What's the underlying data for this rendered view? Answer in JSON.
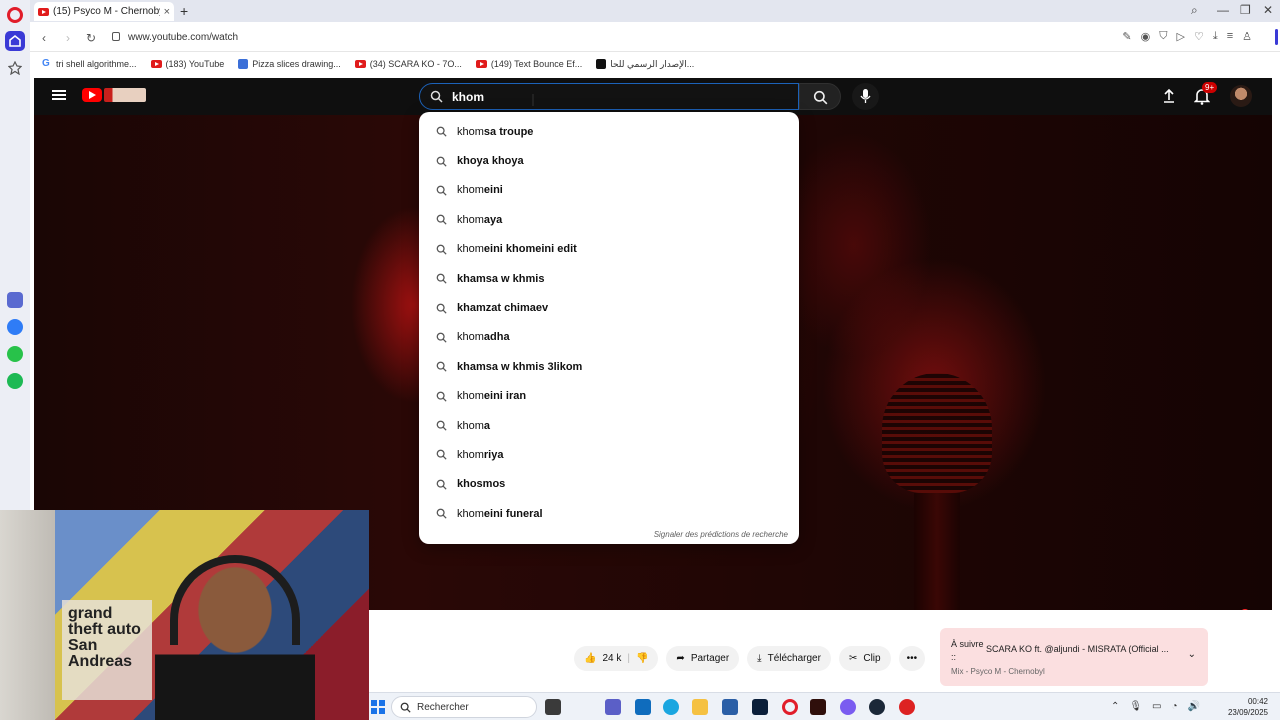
{
  "browser": {
    "tab_title": "(15) Psyco M - Chernobyl",
    "new_tab": "+",
    "url": "www.youtube.com/watch"
  },
  "bookmarks": [
    {
      "label": "tri shell algorithme...",
      "icon": "google-icon",
      "color": "#4285f4"
    },
    {
      "label": "(183) YouTube",
      "icon": "youtube-icon",
      "color": "#e01b1b"
    },
    {
      "label": "Pizza slices drawing...",
      "icon": "doc-icon",
      "color": "#3b6fd8"
    },
    {
      "label": "(34) SCARA KO - 7O...",
      "icon": "youtube-icon",
      "color": "#e01b1b"
    },
    {
      "label": "(149) Text Bounce Ef...",
      "icon": "youtube-icon",
      "color": "#e01b1b"
    },
    {
      "label": "الإصدار الرسمي للحا...",
      "icon": "app-icon",
      "color": "#111111"
    }
  ],
  "youtube": {
    "search_value": "khom",
    "notification_badge": "9+",
    "suggestions": [
      {
        "typed": "khom",
        "rest": "sa troupe"
      },
      {
        "typed": "",
        "rest": "khoya khoya"
      },
      {
        "typed": "khom",
        "rest": "eini"
      },
      {
        "typed": "khom",
        "rest": "aya"
      },
      {
        "typed": "khom",
        "rest": "eini khomeini edit"
      },
      {
        "typed": "",
        "rest": "khamsa w khmis"
      },
      {
        "typed": "",
        "rest": "khamzat chimaev"
      },
      {
        "typed": "khom",
        "rest": "adha"
      },
      {
        "typed": "",
        "rest": "khamsa w khmis 3likom"
      },
      {
        "typed": "khom",
        "rest": "eini iran"
      },
      {
        "typed": "khom",
        "rest": "a"
      },
      {
        "typed": "khom",
        "rest": "riya"
      },
      {
        "typed": "",
        "rest": "khosmos"
      },
      {
        "typed": "khom",
        "rest": "eini funeral"
      }
    ],
    "report_link": "Signaler des prédictions de recherche",
    "progress": 0.99,
    "actions": {
      "likes": "24 k",
      "share": "Partager",
      "download": "Télécharger",
      "clip": "Clip",
      "more": "•••"
    },
    "up_next": {
      "label": "À suivre ::",
      "title": "SCARA KO ft. @aljundi - MISRATA (Official ...",
      "subtitle": "Mix - Psyco M - Chernobyl"
    }
  },
  "webcam": {
    "gta_text": "grand theft auto San Andreas"
  },
  "taskbar": {
    "search_placeholder": "Rechercher",
    "time": "00:42",
    "date": "23/09/2025"
  },
  "colors": {
    "youtube_red": "#ff0000",
    "opera_red": "#e11d2a",
    "search_focus": "#1c62b9",
    "up_next_bg": "#fbdfe0"
  }
}
